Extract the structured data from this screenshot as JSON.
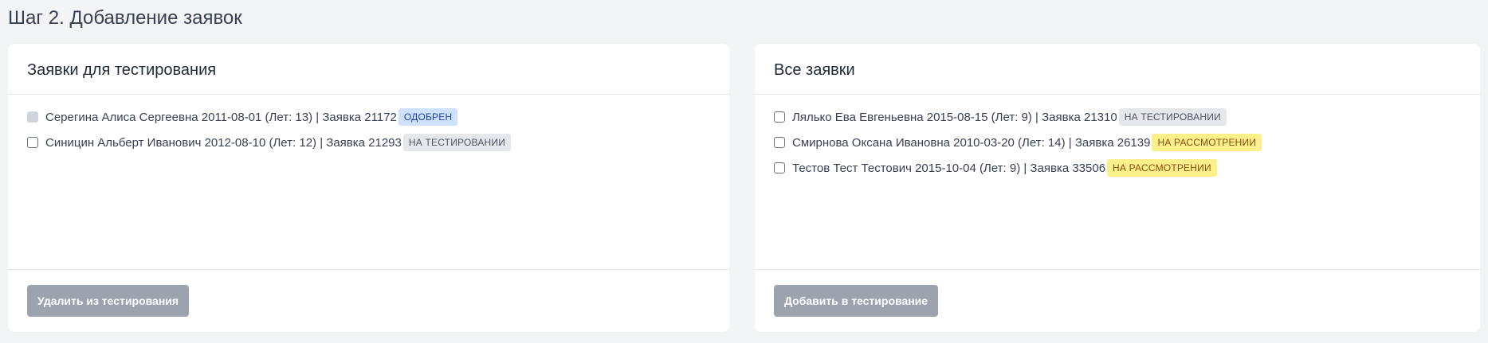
{
  "step_title": "Шаг 2. Добавление заявок",
  "testing_panel": {
    "title": "Заявки для тестирования",
    "button_label": "Удалить из тестирования",
    "items": [
      {
        "text": "Серегина Алиса Сергеевна 2011-08-01 (Лет: 13) | Заявка 21172",
        "badge": "ОДОБРЕН",
        "badge_bg": "#cfe2fb",
        "badge_color": "#1e40af",
        "disabled": true
      },
      {
        "text": "Синицин Альберт Иванович 2012-08-10 (Лет: 12) | Заявка 21293",
        "badge": "НА ТЕСТИРОВАНИИ",
        "badge_bg": "#e5e7eb",
        "badge_color": "#4b5563",
        "disabled": false
      }
    ]
  },
  "all_panel": {
    "title": "Все заявки",
    "button_label": "Добавить в тестирование",
    "items": [
      {
        "text": "Лялько Ева Евгеньевна 2015-08-15 (Лет: 9) | Заявка 21310",
        "badge": "НА ТЕСТИРОВАНИИ",
        "badge_bg": "#e5e7eb",
        "badge_color": "#4b5563",
        "disabled": false
      },
      {
        "text": "Смирнова Оксана Ивановна 2010-03-20 (Лет: 14) | Заявка 26139",
        "badge": "НА РАССМОТРЕНИИ",
        "badge_bg": "#fdf08a",
        "badge_color": "#854d0e",
        "disabled": false
      },
      {
        "text": "Тестов Тест Тестович 2015-10-04 (Лет: 9) | Заявка 33506",
        "badge": "НА РАССМОТРЕНИИ",
        "badge_bg": "#fdf08a",
        "badge_color": "#854d0e",
        "disabled": false
      }
    ]
  }
}
